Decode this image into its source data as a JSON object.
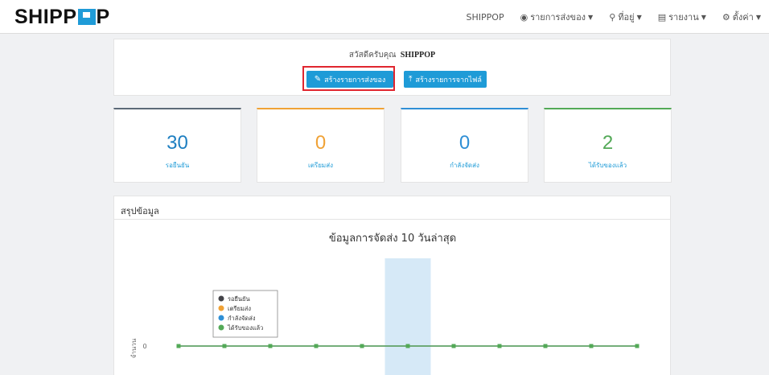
{
  "brand": {
    "logo_left": "SHIPP",
    "logo_right": "P"
  },
  "nav": {
    "company": "SHIPPOP",
    "items": [
      {
        "label": "รายการส่งของ",
        "icon": "truck-icon"
      },
      {
        "label": "ที่อยู่",
        "icon": "map-pin-icon"
      },
      {
        "label": "รายงาน",
        "icon": "document-icon"
      },
      {
        "label": "ตั้งค่า",
        "icon": "gear-icon"
      }
    ]
  },
  "welcome": {
    "greeting": "สวัสดีครับคุณ",
    "user": "SHIPPOP",
    "create_button": "สร้างรายการส่งของ",
    "import_button": "สร้างรายการจากไฟล์"
  },
  "stats": [
    {
      "value": "30",
      "label": "รอยืนยัน",
      "color": "#5c6a78"
    },
    {
      "value": "0",
      "label": "เตรียมส่ง",
      "color": "#f0a236"
    },
    {
      "value": "0",
      "label": "กำลังจัดส่ง",
      "color": "#2f8fd5"
    },
    {
      "value": "2",
      "label": "ได้รับของแล้ว",
      "color": "#53a957"
    }
  ],
  "summary": {
    "title": "สรุปข้อมูล"
  },
  "chart_data": {
    "type": "line",
    "title": "ข้อมูลการจัดส่ง 10 วันล่าสุด",
    "ylabel": "จำนวน",
    "y_ticks": [
      "0"
    ],
    "legend_position": "left",
    "highlighted_point_index": 5,
    "series": [
      {
        "name": "รอยืนยัน",
        "color": "#434348",
        "values": [
          0,
          0,
          0,
          0,
          0,
          0,
          0,
          0,
          0,
          0,
          0
        ]
      },
      {
        "name": "เตรียมส่ง",
        "color": "#f0a236",
        "values": [
          0,
          0,
          0,
          0,
          0,
          0,
          0,
          0,
          0,
          0,
          0
        ]
      },
      {
        "name": "กำลังจัดส่ง",
        "color": "#2f8fd5",
        "values": [
          0,
          0,
          0,
          0,
          0,
          0,
          0,
          0,
          0,
          0,
          0
        ]
      },
      {
        "name": "ได้รับของแล้ว",
        "color": "#53a957",
        "values": [
          0,
          0,
          0,
          0,
          0,
          0,
          0,
          0,
          0,
          0,
          0
        ]
      }
    ]
  }
}
